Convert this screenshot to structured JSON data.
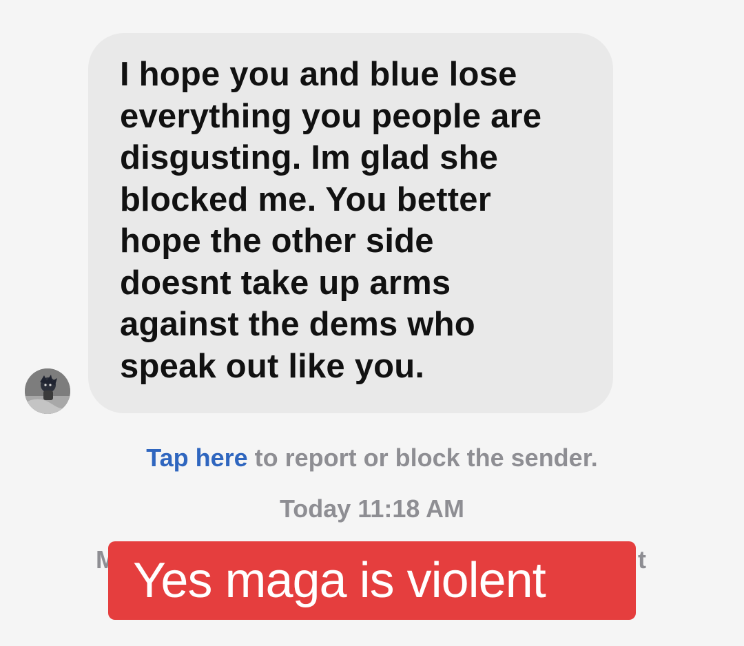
{
  "message": {
    "lines": [
      "I hope you and blue lose",
      "everything you people are",
      "disgusting. Im glad she",
      "blocked me. You better",
      "hope the other side",
      "doesnt take up arms",
      "against the dems who",
      "speak out like you."
    ],
    "bubble_color": "#e9e9e9",
    "text_color": "#111111"
  },
  "sender": {
    "avatar_icon": "profile-photo"
  },
  "report": {
    "link_text": "Tap here",
    "rest_text": " to report or block the sender.",
    "link_color": "#2f66bf"
  },
  "timestamp": "Today 11:18 AM",
  "obscured_line": {
    "left_fragment": "M",
    "right_fragment": "t"
  },
  "caption": {
    "text": "Yes maga is violent",
    "background": "#e53e3e"
  }
}
